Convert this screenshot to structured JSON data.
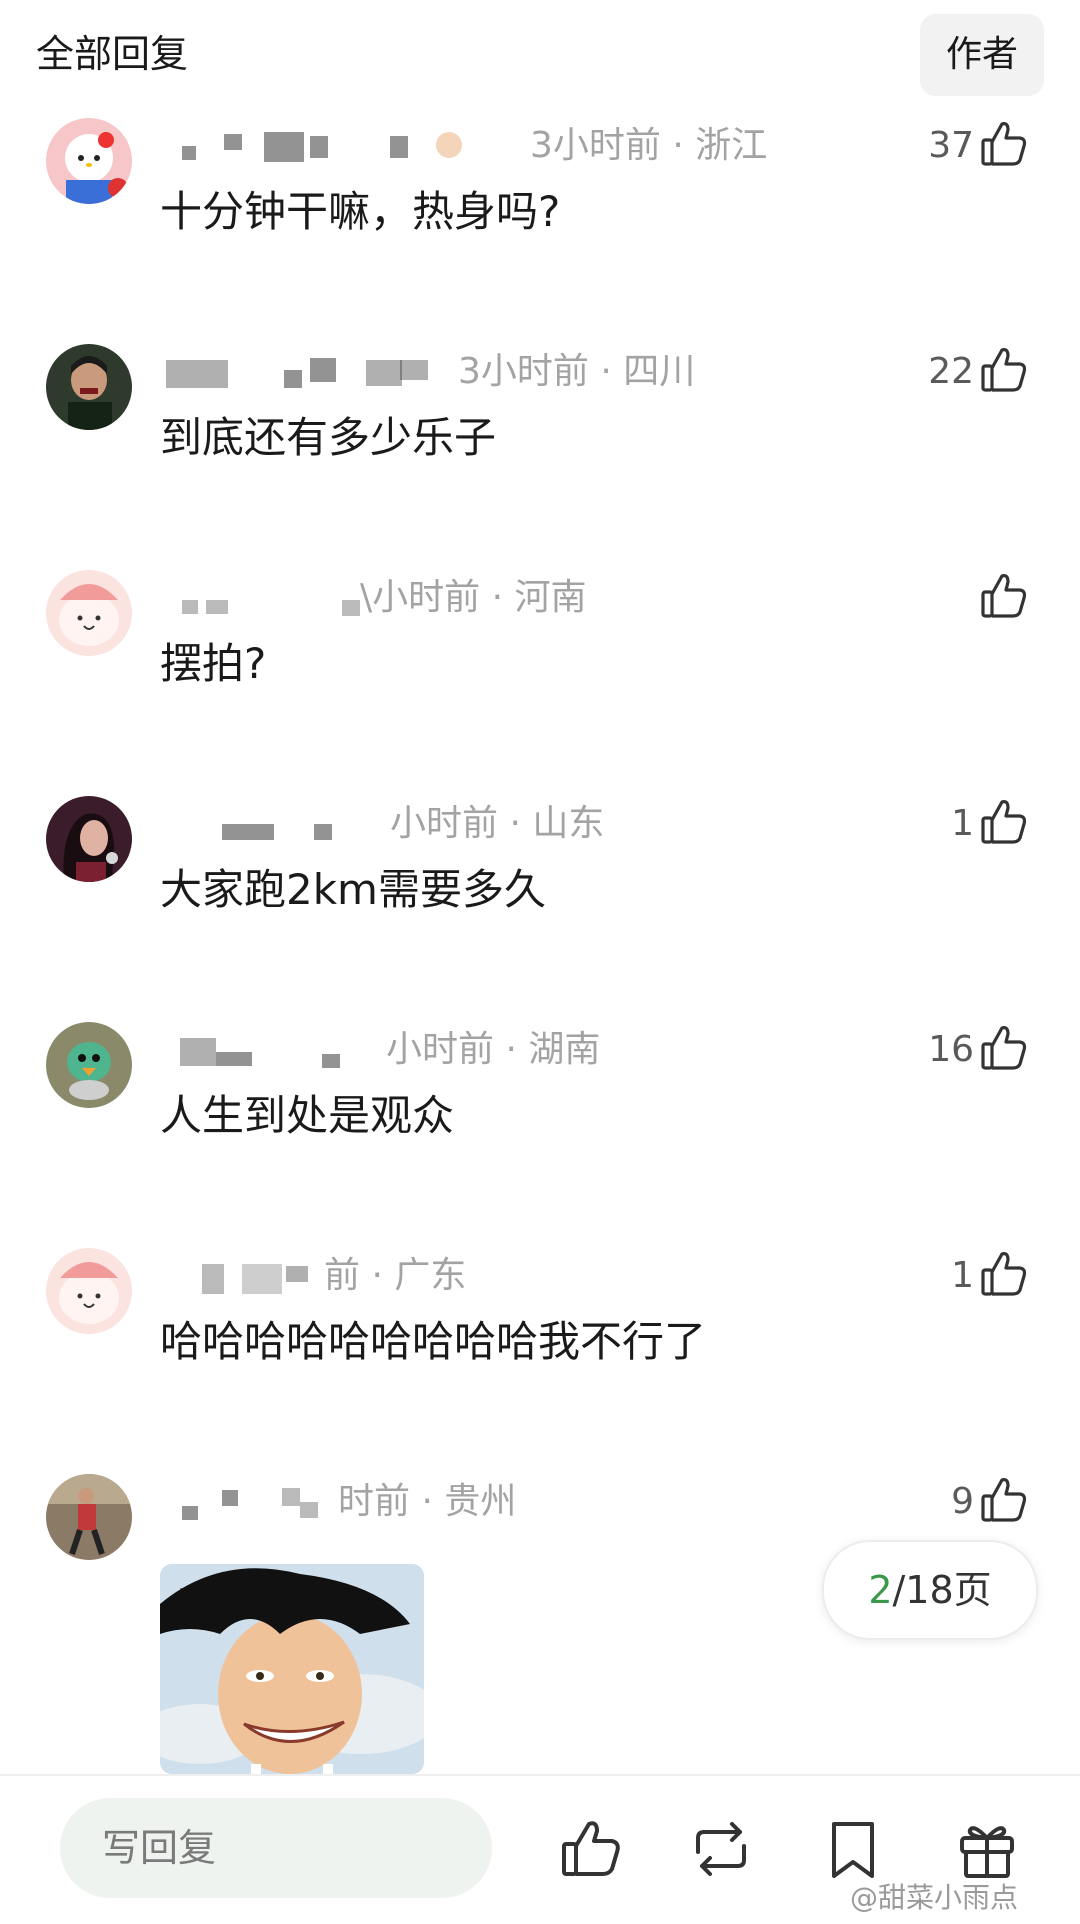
{
  "header": {
    "title": "全部回复",
    "author_button": "作者"
  },
  "comments": [
    {
      "meta": "3小时前 · 浙江",
      "likes": "37",
      "text": "十分钟干嘛，热身吗?",
      "avatar": "hello-kitty-avatar"
    },
    {
      "meta": "3小时前 · 四川",
      "likes": "22",
      "text": "到底还有多少乐子",
      "avatar": "person-avatar"
    },
    {
      "meta": "\\小时前 · 河南",
      "likes": "",
      "text": "摆拍?",
      "avatar": "pink-cartoon-avatar"
    },
    {
      "meta": "小时前 · 山东",
      "likes": "1",
      "text": "大家跑2km需要多久",
      "avatar": "woman-singer-avatar"
    },
    {
      "meta": "小时前 · 湖南",
      "likes": "16",
      "text": "人生到处是观众",
      "avatar": "green-bird-avatar"
    },
    {
      "meta": "前 · 广东",
      "likes": "1",
      "text": "哈哈哈哈哈哈哈哈哈我不行了",
      "avatar": "pink-cartoon-avatar"
    },
    {
      "meta": "时前 · 贵州",
      "likes": "9",
      "text": "",
      "avatar": "person-street-avatar"
    }
  ],
  "pagination": {
    "current": "2",
    "rest": "/18页"
  },
  "bottom_bar": {
    "reply_placeholder": "写回复",
    "icons": [
      "like-icon",
      "repost-icon",
      "bookmark-icon",
      "gift-icon"
    ]
  },
  "watermark": "@甜菜小雨点",
  "colors": {
    "meta_gray": "#a3a3a3",
    "page_current_green": "#3a9a4a",
    "input_bg": "#eef3ef"
  }
}
